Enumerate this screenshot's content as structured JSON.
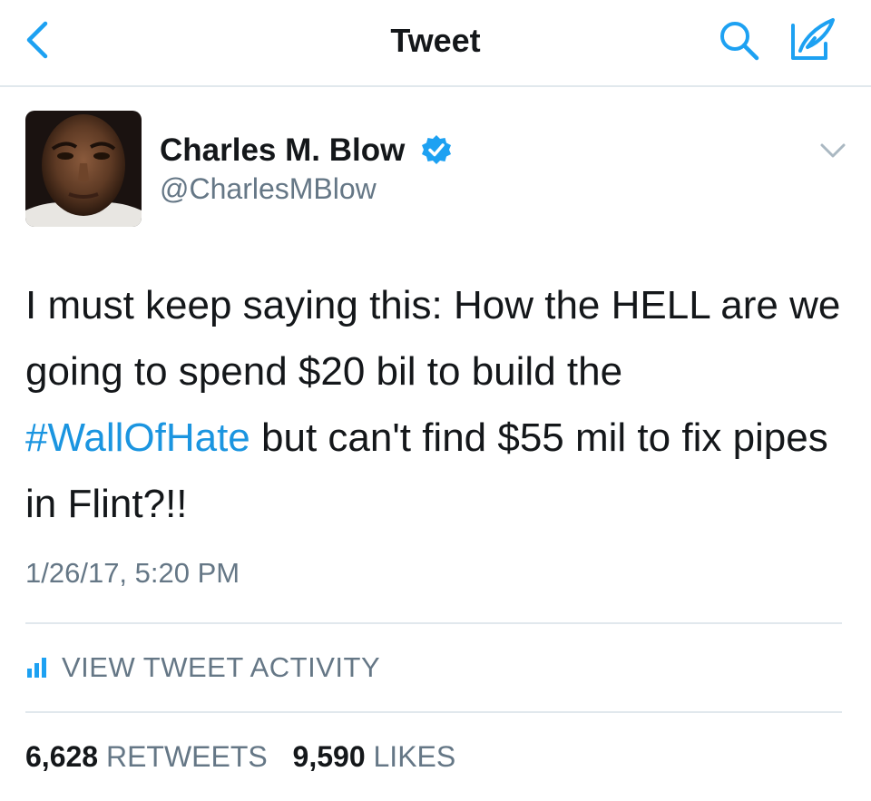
{
  "navbar": {
    "title": "Tweet",
    "back_icon": "chevron-left-icon",
    "search_icon": "search-icon",
    "compose_icon": "compose-icon",
    "accent_color": "#1da1f2"
  },
  "tweet": {
    "author_name": "Charles M. Blow",
    "author_handle": "@CharlesMBlow",
    "verified": true,
    "text_part1": "I must keep saying this: How the HELL are we going to spend $20 bil to build the ",
    "hashtag": "#WallOfHate",
    "text_part2": " but can't find $55 mil to fix pipes in Flint?!!",
    "timestamp": "1/26/17, 5:20 PM",
    "activity_label": "VIEW TWEET ACTIVITY",
    "retweets_count": "6,628",
    "retweets_label": "RETWEETS",
    "likes_count": "9,590",
    "likes_label": "LIKES",
    "hashtag_color": "#1b95e0"
  }
}
